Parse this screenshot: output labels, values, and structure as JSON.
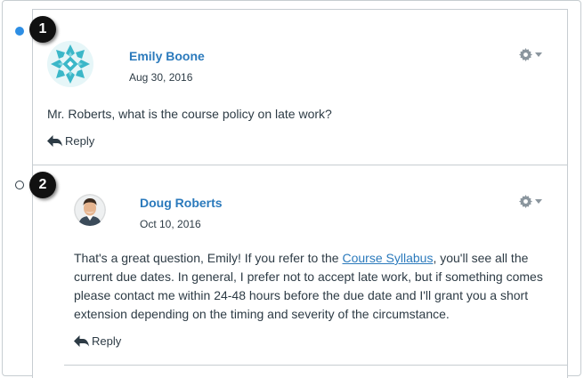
{
  "entries": [
    {
      "callout": "1",
      "read_state": "unread",
      "author": "Emily Boone",
      "date": "Aug 30, 2016",
      "message": "Mr. Roberts, what is the course policy on late work?",
      "reply_label": "Reply",
      "avatar_icon": "geometric-pattern-avatar"
    },
    {
      "callout": "2",
      "read_state": "read",
      "author": "Doug Roberts",
      "date": "Oct 10, 2016",
      "message_before_link": "That's a great question, Emily! If you refer to the ",
      "link_text": "Course Syllabus",
      "message_after_link_line1": ", you'll see all the",
      "message_line2": "current due dates. In general, I prefer not to accept late work, but if something comes",
      "message_line3": "please contact me within 24-48 hours before the due date and I'll grant you a short",
      "message_line4": "extension depending on the timing and severity of the circumstance.",
      "reply_label": "Reply",
      "avatar_icon": "person-photo-avatar"
    }
  ],
  "colors": {
    "accent": "#2b7abc",
    "unread_dot": "#2d8ee4",
    "text": "#2d3b45",
    "border": "#c7cdd1"
  },
  "icons": {
    "settings": "gear-icon",
    "reply": "reply-arrow-icon"
  }
}
